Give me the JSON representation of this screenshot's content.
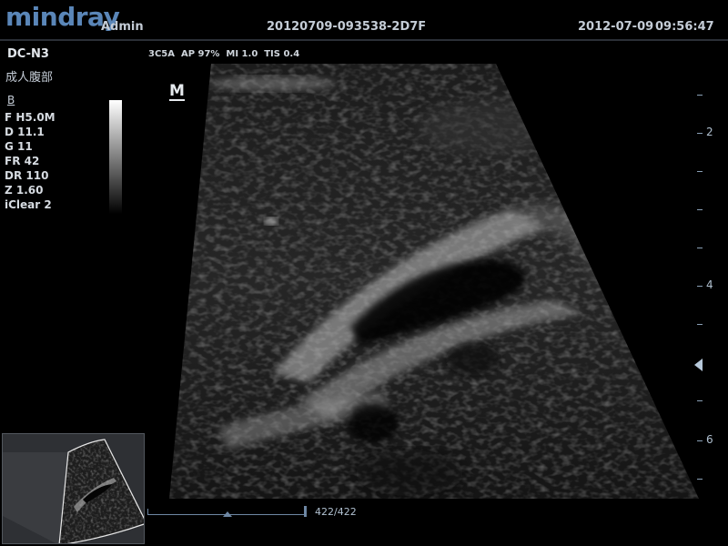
{
  "header": {
    "logo": "mindray",
    "user": "Admin",
    "study_id": "20120709-093538-2D7F",
    "date": "2012-07-09",
    "time": "09:56:47"
  },
  "probe": {
    "name": "DC-N3",
    "exam": "成人腹部"
  },
  "status_line": "3C5A  AP 97%  MI 1.0  TIS 0.4",
  "params": {
    "mode": "B",
    "items": [
      "F H5.0M",
      "D 11.1",
      "G 11",
      "FR 42",
      "DR 110",
      "Z 1.60",
      "iClear 2"
    ]
  },
  "image": {
    "orientation_marker": "M"
  },
  "depth_scale": {
    "labels": [
      "2",
      "4",
      "6"
    ]
  },
  "cine": {
    "frame_counter": "422/422",
    "position": 1.0
  },
  "colors": {
    "logo": "#5a86b8",
    "scale": "#8aa0b6"
  }
}
